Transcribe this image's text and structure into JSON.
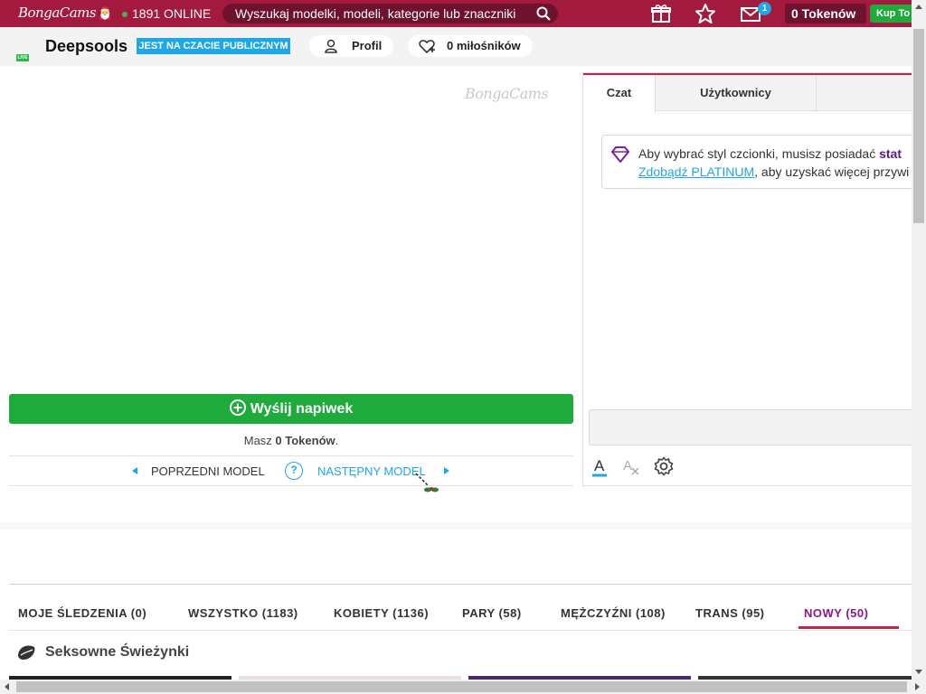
{
  "topbar": {
    "logo": "BongaCams",
    "online_count": "1891 ONLINE",
    "search_placeholder": "Wyszukaj modelki, modeli, kategorie lub znaczniki",
    "messages_badge": "1",
    "tokens": "0 Tokenów",
    "buy_label": "Kup To"
  },
  "model": {
    "name": "Deepsools",
    "live_tag": "LIVE",
    "status": "JEST NA CZACIE PUBLICZNYM",
    "profile_label": "Profil",
    "fans_label": "0 miłośników"
  },
  "video": {
    "watermark": "BongaCams",
    "tip_button": "Wyślij napiwek",
    "tokens_prefix": "Masz",
    "tokens_value": "0 Tokenów",
    "tokens_suffix": ".",
    "prev_model": "POPRZEDNI MODEL",
    "next_model": "NASTĘPNY MODEL",
    "help": "?"
  },
  "chat": {
    "tabs": [
      "Czat",
      "Użytkownicy"
    ],
    "notice_line1_start": "Aby wybrać styl czcionki, musisz posiadać ",
    "notice_line1_bold": "stat",
    "notice_link": "Zdobądź PLATINUM",
    "notice_line2_rest": ", aby uzyskać więcej przywi"
  },
  "categories": {
    "tabs": [
      "MOJE ŚLEDZENIA (0)",
      "WSZYSTKO (1183)",
      "KOBIETY (1136)",
      "PARY (58)",
      "MĘŻCZYŹNI (108)",
      "TRANS (95)",
      "NOWY (50)"
    ],
    "active_index": 6,
    "section_title": "Seksowne Świeżynki"
  },
  "colors": {
    "brand": "#a31a3e",
    "green": "#1faa3c",
    "blue": "#1ea7e6",
    "active_tab": "#8a1a8a"
  }
}
